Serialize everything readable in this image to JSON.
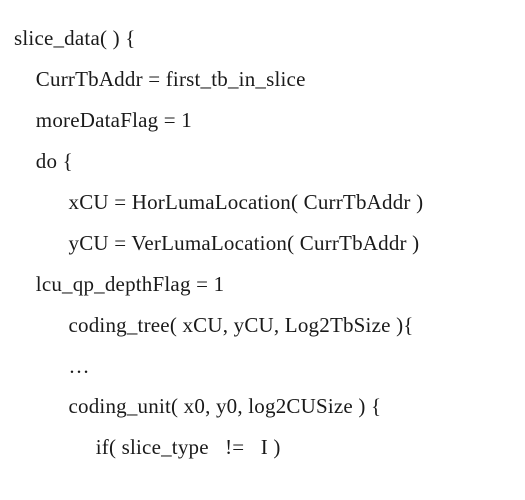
{
  "code": {
    "lines": [
      "slice_data( ) {",
      "    CurrTbAddr = first_tb_in_slice",
      "    moreDataFlag = 1",
      "    do {",
      "          xCU = HorLumaLocation( CurrTbAddr )",
      "          yCU = VerLumaLocation( CurrTbAddr )",
      "    lcu_qp_depthFlag = 1",
      "          coding_tree( xCU, yCU, Log2TbSize ){",
      "          …",
      "          coding_unit( x0, y0, log2CUSize ) {",
      "               if( slice_type   !=   I )"
    ]
  }
}
